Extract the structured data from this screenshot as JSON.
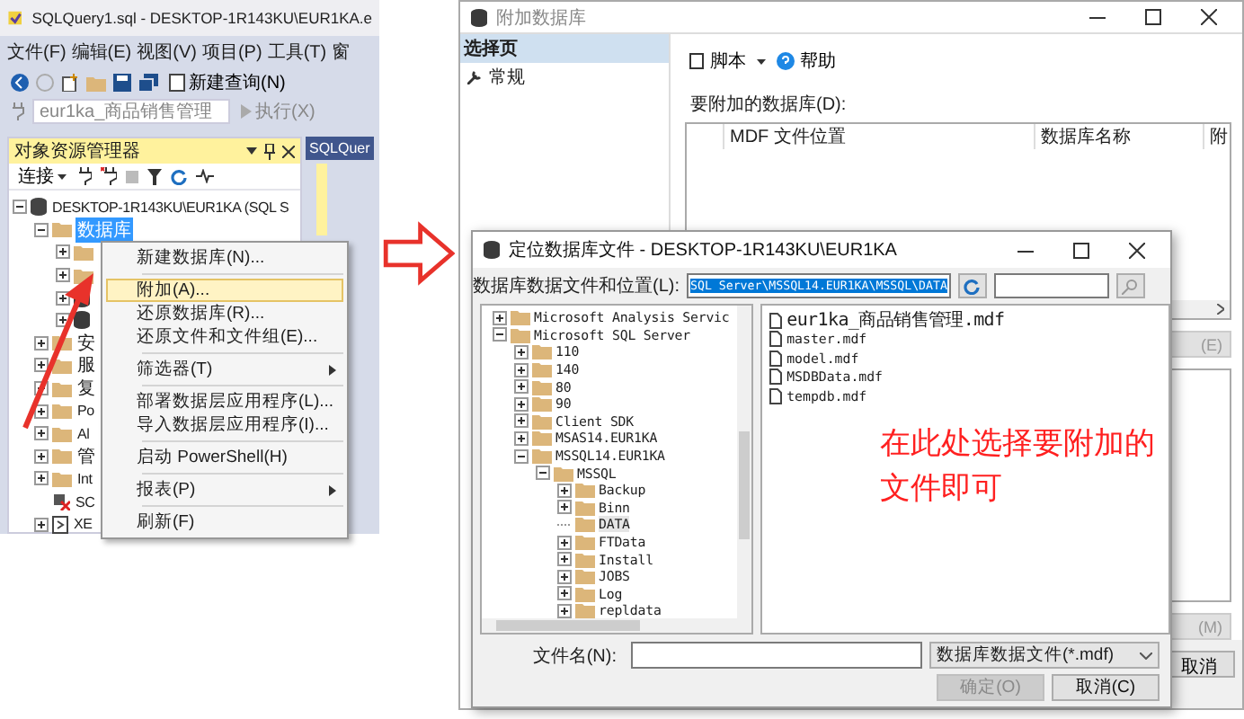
{
  "ssms": {
    "title": "SQLQuery1.sql - DESKTOP-1R143KU\\EUR1KA.e",
    "menu": [
      "文件(F)",
      "编辑(E)",
      "视图(V)",
      "项目(P)",
      "工具(T)",
      "窗"
    ],
    "new_query": "新建查询(N)",
    "database_dropdown": "eur1ka_商品销售管理",
    "execute": "执行(X)",
    "explorer": {
      "title": "对象资源管理器",
      "connect": "连接",
      "tree": [
        {
          "kind": "server",
          "label": "DESKTOP-1R143KU\\EUR1KA (SQL S",
          "expanded": true,
          "selected": false,
          "children": [
            {
              "kind": "folder",
              "label": "数据库",
              "expanded": true,
              "selected": true,
              "children": [
                {
                  "kind": "folder",
                  "expanded": false
                },
                {
                  "kind": "folder",
                  "expanded": false
                },
                {
                  "kind": "database",
                  "expanded": false
                },
                {
                  "kind": "database",
                  "expanded": false
                }
              ]
            },
            {
              "kind": "folder",
              "label": "安",
              "expanded": false,
              "selected": false
            },
            {
              "kind": "folder",
              "label": "服",
              "expanded": false,
              "selected": false
            },
            {
              "kind": "folder",
              "label": "复",
              "expanded": false,
              "selected": false
            },
            {
              "kind": "folder",
              "label": "Po",
              "expanded": false,
              "selected": false
            },
            {
              "kind": "folder",
              "label": "Al",
              "expanded": false,
              "selected": false
            },
            {
              "kind": "folder",
              "label": "管",
              "expanded": false,
              "selected": false
            },
            {
              "kind": "folder",
              "label": "Int",
              "expanded": false,
              "selected": false
            },
            {
              "kind": "agent",
              "label": "SC",
              "selected": false
            },
            {
              "kind": "profiler",
              "label": "XE",
              "expanded": false,
              "selected": false
            }
          ]
        }
      ]
    },
    "doc_tab": "SQLQuer",
    "context_menu": [
      [
        {
          "label": "新建数据库(N)...",
          "selected": false
        }
      ],
      [
        {
          "label": "附加(A)...",
          "selected": true
        },
        {
          "label": "还原数据库(R)...",
          "selected": false
        },
        {
          "label": "还原文件和文件组(E)...",
          "selected": false
        }
      ],
      [
        {
          "label": "筛选器(T)",
          "selected": false,
          "submenu": true
        }
      ],
      [
        {
          "label": "部署数据层应用程序(L)...",
          "selected": false
        },
        {
          "label": "导入数据层应用程序(I)...",
          "selected": false
        }
      ],
      [
        {
          "label": "启动 PowerShell(H)",
          "selected": false
        }
      ],
      [
        {
          "label": "报表(P)",
          "selected": false,
          "submenu": true
        }
      ],
      [
        {
          "label": "刷新(F)",
          "selected": false
        }
      ]
    ]
  },
  "attach": {
    "title": "附加数据库",
    "pages_header": "选择页",
    "pages": [
      {
        "label": "常规",
        "selected": false
      }
    ],
    "script": "脚本",
    "help": "帮助",
    "list_label": "要附加的数据库(D):",
    "columns": [
      "MDF 文件位置",
      "数据库名称",
      "附"
    ],
    "button_e": "(E)",
    "button_m": "(M)",
    "cancel": "取消"
  },
  "locate": {
    "title": "定位数据库文件 - DESKTOP-1R143KU\\EUR1KA",
    "path_label": "数据库数据文件和位置(L):",
    "path": "SQL Server\\MSSQL14.EUR1KA\\MSSQL\\DATA",
    "tree": [
      {
        "label": "Microsoft Analysis Servic",
        "expanded": false,
        "selected": false
      },
      {
        "label": "Microsoft SQL Server",
        "expanded": true,
        "selected": false,
        "children": [
          {
            "label": "110",
            "expanded": false,
            "selected": false
          },
          {
            "label": "140",
            "expanded": false,
            "selected": false
          },
          {
            "label": "80",
            "expanded": false,
            "selected": false
          },
          {
            "label": "90",
            "expanded": false,
            "selected": false
          },
          {
            "label": "Client SDK",
            "expanded": false,
            "selected": false
          },
          {
            "label": "MSAS14.EUR1KA",
            "expanded": false,
            "selected": false
          },
          {
            "label": "MSSQL14.EUR1KA",
            "expanded": true,
            "selected": false,
            "children": [
              {
                "label": "MSSQL",
                "expanded": true,
                "selected": false,
                "children": [
                  {
                    "label": "Backup",
                    "expanded": false,
                    "selected": false
                  },
                  {
                    "label": "Binn",
                    "expanded": false,
                    "selected": false
                  },
                  {
                    "label": "DATA",
                    "selected": true
                  },
                  {
                    "label": "FTData",
                    "expanded": false,
                    "selected": false
                  },
                  {
                    "label": "Install",
                    "expanded": false,
                    "selected": false
                  },
                  {
                    "label": "JOBS",
                    "expanded": false,
                    "selected": false
                  },
                  {
                    "label": "Log",
                    "expanded": false,
                    "selected": false
                  },
                  {
                    "label": "repldata",
                    "expanded": false,
                    "selected": false
                  }
                ]
              }
            ]
          }
        ]
      }
    ],
    "files": [
      "eur1ka_商品销售管理.mdf",
      "master.mdf",
      "model.mdf",
      "MSDBData.mdf",
      "tempdb.mdf"
    ],
    "annotation": "在此处选择要附加的文件即可",
    "filename_label": "文件名(N):",
    "filetype": "数据库数据文件(*.mdf)",
    "ok": {
      "label": "确定(O)",
      "disabled": true
    },
    "cancel": {
      "label": "取消(C)",
      "disabled": false
    }
  }
}
